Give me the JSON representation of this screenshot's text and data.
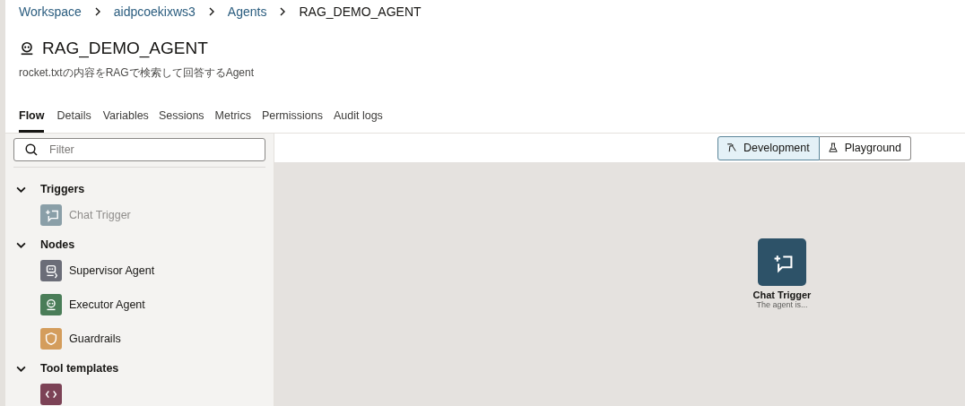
{
  "breadcrumbs": [
    {
      "label": "Workspace",
      "link": true
    },
    {
      "label": "aidpcoekixws3",
      "link": true
    },
    {
      "label": "Agents",
      "link": true
    },
    {
      "label": "RAG_DEMO_AGENT",
      "link": false
    }
  ],
  "title": "RAG_DEMO_AGENT",
  "description": "rocket.txtの内容をRAGで検索して回答するAgent",
  "tabs": [
    {
      "label": "Flow",
      "selected": true
    },
    {
      "label": "Details",
      "selected": false
    },
    {
      "label": "Variables",
      "selected": false
    },
    {
      "label": "Sessions",
      "selected": false
    },
    {
      "label": "Metrics",
      "selected": false
    },
    {
      "label": "Permissions",
      "selected": false
    },
    {
      "label": "Audit logs",
      "selected": false
    }
  ],
  "filter": {
    "placeholder": "Filter"
  },
  "palette": [
    {
      "label": "Triggers",
      "expanded": true,
      "children": [
        {
          "label": "Chat Trigger",
          "kind": "chat",
          "color": "#8a9fa8",
          "disabled": true
        }
      ]
    },
    {
      "label": "Nodes",
      "expanded": true,
      "children": [
        {
          "label": "Supervisor Agent",
          "kind": "supervisor",
          "color": "#6b6d78",
          "disabled": false
        },
        {
          "label": "Executor Agent",
          "kind": "executor",
          "color": "#4a7d58",
          "disabled": false
        },
        {
          "label": "Guardrails",
          "kind": "shield",
          "color": "#d49d5c",
          "disabled": false
        }
      ]
    },
    {
      "label": "Tool templates",
      "expanded": true,
      "children": [
        {
          "kind": "code",
          "color": "#7c4256"
        }
      ]
    }
  ],
  "modes": [
    {
      "label": "Development",
      "kind": "hammer",
      "selected": true
    },
    {
      "label": "Playground",
      "kind": "flask",
      "selected": false
    }
  ],
  "canvas_nodes": [
    {
      "title": "Chat Trigger",
      "subtitle": "The agent is...",
      "kind": "chat",
      "color": "#2d5268"
    }
  ]
}
